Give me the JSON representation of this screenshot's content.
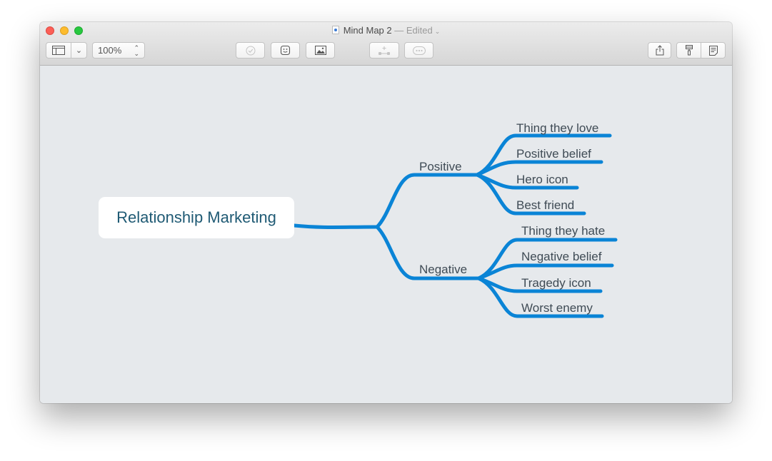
{
  "window": {
    "title": "Mind Map 2",
    "status": "— Edited",
    "status_chevron": "⌄"
  },
  "toolbar": {
    "zoom_value": "100%",
    "zoom_arrows_up": "⌃",
    "zoom_arrows_down": "⌄",
    "sidebar_chevron": "⌄"
  },
  "mindmap": {
    "root": "Relationship Marketing",
    "branches": [
      {
        "label": "Positive",
        "children": [
          "Thing they love",
          "Positive belief",
          "Hero icon",
          "Best friend"
        ]
      },
      {
        "label": "Negative",
        "children": [
          "Thing they hate",
          "Negative belief",
          "Tragedy icon",
          "Worst enemy"
        ]
      }
    ]
  },
  "colors": {
    "accent": "#0a84d6",
    "canvas_bg": "#e6e9ec",
    "root_text": "#1f5a74",
    "node_text": "#3f4b55"
  }
}
